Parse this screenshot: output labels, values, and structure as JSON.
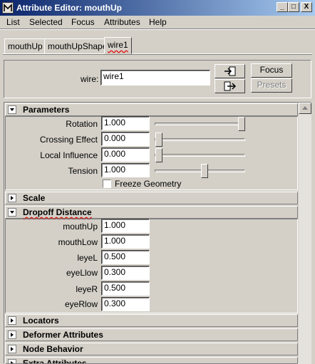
{
  "window": {
    "title": "Attribute Editor: mouthUp",
    "buttons": [
      "_",
      "□",
      "X"
    ]
  },
  "menu": [
    "List",
    "Selected",
    "Focus",
    "Attributes",
    "Help"
  ],
  "tabs": [
    "mouthUp",
    "mouthUpShape",
    "wire1"
  ],
  "header": {
    "node_label": "wire:",
    "node_value": "wire1",
    "focus_label": "Focus",
    "presets_label": "Presets"
  },
  "sections": {
    "parameters": "Parameters",
    "scale": "Scale",
    "dropoff": "Dropoff Distance",
    "locators": "Locators",
    "deformer": "Deformer Attributes",
    "node_behavior": "Node Behavior",
    "extra": "Extra Attributes"
  },
  "parameters": {
    "rotation": {
      "label": "Rotation",
      "value": "1.000",
      "slider": 1.0
    },
    "crossing": {
      "label": "Crossing Effect",
      "value": "0.000",
      "slider": 0.0
    },
    "local": {
      "label": "Local Influence",
      "value": "0.000",
      "slider": 0.0
    },
    "tension": {
      "label": "Tension",
      "value": "1.000",
      "slider": 0.55
    },
    "freeze_label": "Freeze Geometry"
  },
  "dropoff": [
    {
      "label": "mouthUp",
      "value": "1.000"
    },
    {
      "label": "mouthLow",
      "value": "1.000"
    },
    {
      "label": "leyeL",
      "value": "0.500"
    },
    {
      "label": "eyeLlow",
      "value": "0.300"
    },
    {
      "label": "leyeR",
      "value": "0.500"
    },
    {
      "label": "eyeRlow",
      "value": "0.300"
    }
  ]
}
